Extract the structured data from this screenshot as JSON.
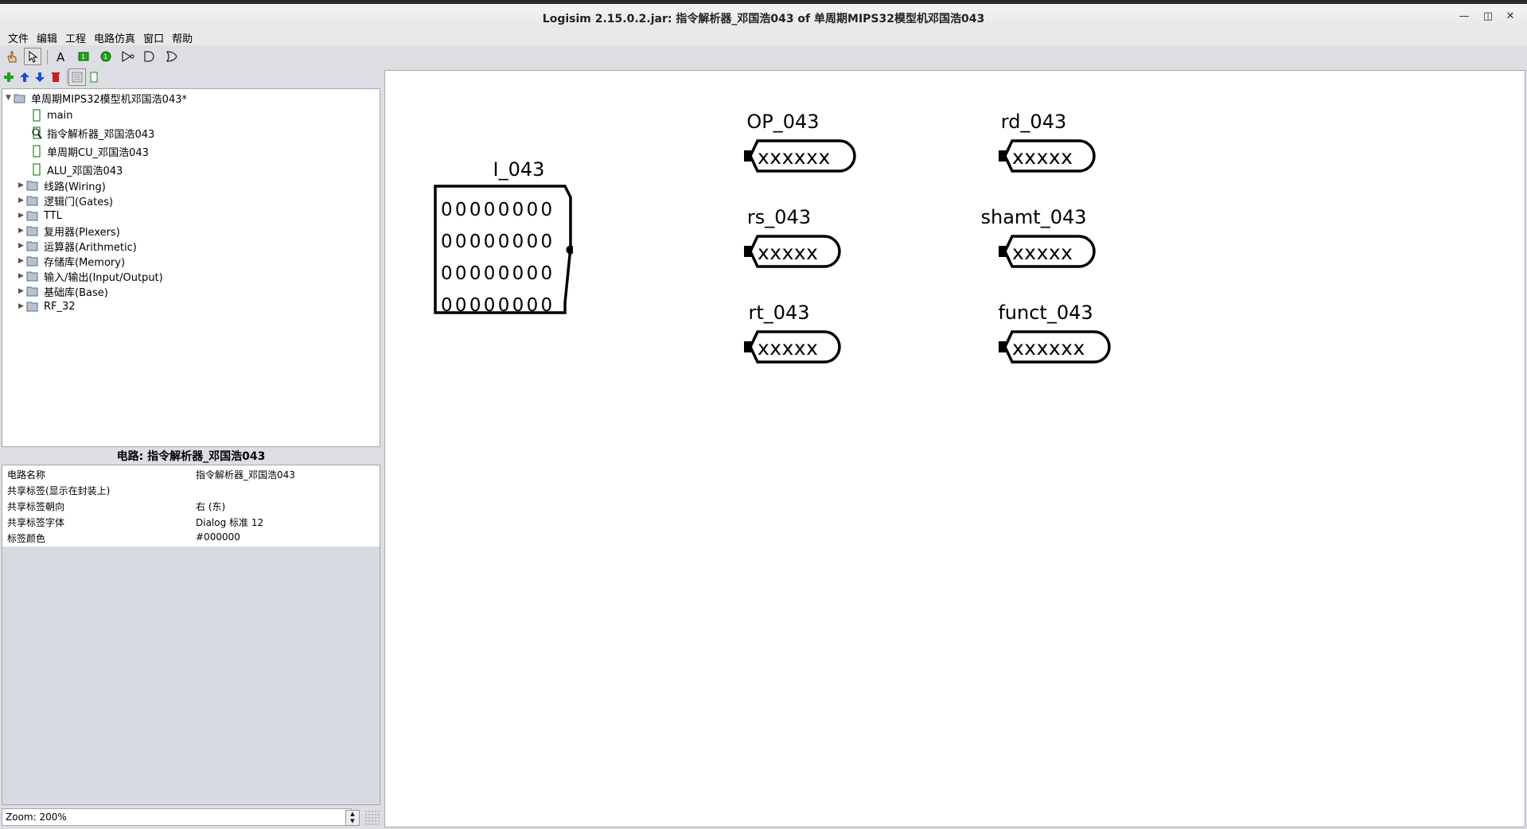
{
  "window": {
    "title": "Logisim 2.15.0.2.jar: 指令解析器_邓国浩043 of 单周期MIPS32模型机邓国浩043",
    "minimize": "—",
    "restore": "◫",
    "close": "✕"
  },
  "menu": [
    "文件",
    "编辑",
    "工程",
    "电路仿真",
    "窗口",
    "帮助"
  ],
  "toolbar": {
    "tools": [
      "poke-icon",
      "select-icon",
      "text-icon",
      "pin-input-icon",
      "pin-output-icon",
      "not-gate-icon",
      "and-gate-icon",
      "or-gate-icon"
    ],
    "project_tools": [
      "add-circuit-icon",
      "move-up-icon",
      "move-down-icon",
      "delete-icon",
      "layout-view-icon",
      "appearance-view-icon"
    ]
  },
  "tree": {
    "root": "单周期MIPS32模型机邓国浩043*",
    "circuits": [
      "main",
      "指令解析器_邓国浩043",
      "单周期CU_邓国浩043",
      "ALU_邓国浩043"
    ],
    "libraries": [
      "线路(Wiring)",
      "逻辑门(Gates)",
      "TTL",
      "复用器(Plexers)",
      "运算器(Arithmetic)",
      "存储库(Memory)",
      "输入/输出(Input/Output)",
      "基础库(Base)",
      "RF_32"
    ]
  },
  "attributes": {
    "header": "电路: 指令解析器_邓国浩043",
    "rows": [
      {
        "key": "电路名称",
        "value": "指令解析器_邓国浩043"
      },
      {
        "key": "共享标签(显示在封装上)",
        "value": ""
      },
      {
        "key": "共享标签朝向",
        "value": "右 (东)"
      },
      {
        "key": "共享标签字体",
        "value": "Dialog 标准 12"
      },
      {
        "key": "标签颜色",
        "value": "#000000"
      }
    ]
  },
  "zoom": "Zoom: 200%",
  "canvas": {
    "input_pin": {
      "label": "I_043",
      "rows": [
        "00000000",
        "00000000",
        "00000000",
        "00000000"
      ]
    },
    "output_pins": [
      {
        "label": "OP_043",
        "value": "xxxxxx"
      },
      {
        "label": "rd_043",
        "value": "xxxxx"
      },
      {
        "label": "rs_043",
        "value": "xxxxx"
      },
      {
        "label": "shamt_043",
        "value": "xxxxx"
      },
      {
        "label": "rt_043",
        "value": "xxxxx"
      },
      {
        "label": "funct_043",
        "value": "xxxxxx"
      }
    ]
  }
}
